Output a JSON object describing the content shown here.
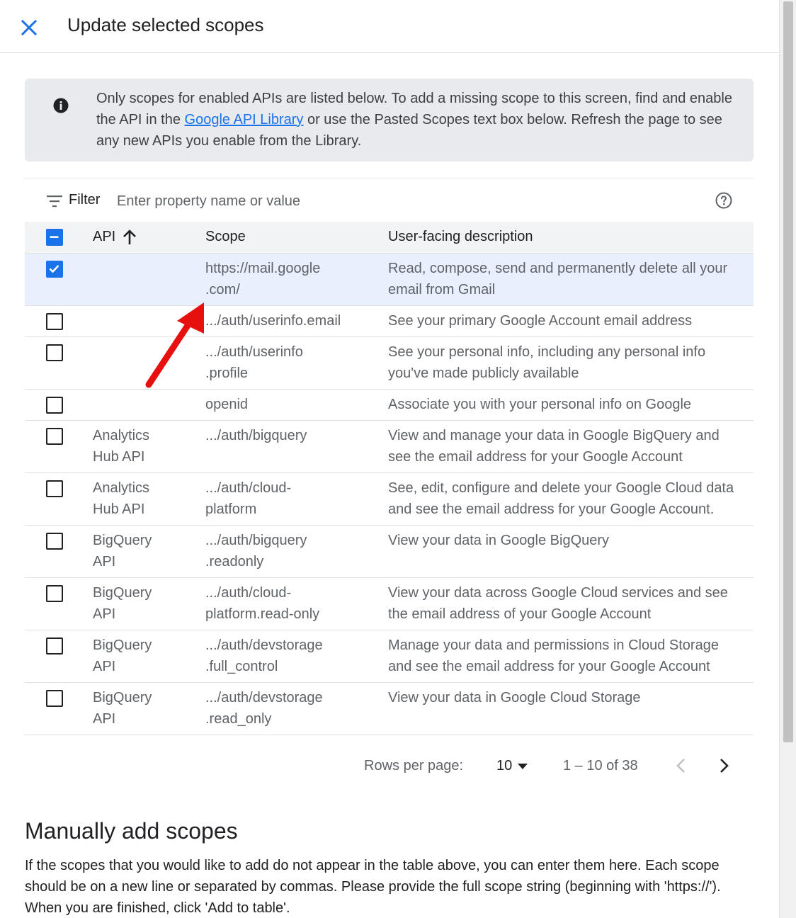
{
  "header": {
    "title": "Update selected scopes"
  },
  "info": {
    "text_before": "Only scopes for enabled APIs are listed below. To add a missing scope to this screen, find and enable the API in the ",
    "link": "Google API Library",
    "text_after": " or use the Pasted Scopes text box below. Refresh the page to see any new APIs you enable from the Library."
  },
  "filter": {
    "label": "Filter",
    "placeholder": "Enter property name or value"
  },
  "table": {
    "columns": {
      "api": "API",
      "scope": "Scope",
      "description": "User-facing description"
    },
    "rows": [
      {
        "api": "",
        "scope": "https://mail.google\n.com/",
        "description": "Read, compose, send and permanently delete all your email from Gmail",
        "checked": true
      },
      {
        "api": "",
        "scope": ".../auth/userinfo.email",
        "description": "See your primary Google Account email address",
        "checked": false
      },
      {
        "api": "",
        "scope": ".../auth/userinfo\n.profile",
        "description": "See your personal info, including any personal info you've made publicly available",
        "checked": false
      },
      {
        "api": "",
        "scope": "openid",
        "description": "Associate you with your personal info on Google",
        "checked": false
      },
      {
        "api": "Analytics\nHub API",
        "scope": ".../auth/bigquery",
        "description": "View and manage your data in Google BigQuery and see the email address for your Google Account",
        "checked": false
      },
      {
        "api": "Analytics\nHub API",
        "scope": ".../auth/cloud-\nplatform",
        "description": "See, edit, configure and delete your Google Cloud data and see the email address for your Google Account.",
        "checked": false
      },
      {
        "api": "BigQuery\nAPI",
        "scope": ".../auth/bigquery\n.readonly",
        "description": "View your data in Google BigQuery",
        "checked": false
      },
      {
        "api": "BigQuery\nAPI",
        "scope": ".../auth/cloud-\nplatform.read-only",
        "description": "View your data across Google Cloud services and see the email address of your Google Account",
        "checked": false
      },
      {
        "api": "BigQuery\nAPI",
        "scope": ".../auth/devstorage\n.full_control",
        "description": "Manage your data and permissions in Cloud Storage and see the email address for your Google Account",
        "checked": false
      },
      {
        "api": "BigQuery\nAPI",
        "scope": ".../auth/devstorage\n.read_only",
        "description": "View your data in Google Cloud Storage",
        "checked": false
      }
    ]
  },
  "pagination": {
    "rows_label": "Rows per page:",
    "rows_value": "10",
    "range": "1 – 10 of 38"
  },
  "manual": {
    "title": "Manually add scopes",
    "text": "If the scopes that you would like to add do not appear in the table above, you can enter them here. Each scope should be on a new line or separated by commas. Please provide the full scope string (beginning with 'https://'). When you are finished, click 'Add to table'."
  },
  "colors": {
    "accent": "#1a73e8",
    "annotation_arrow": "#e8100f",
    "selected_row": "#e8f0fe"
  }
}
